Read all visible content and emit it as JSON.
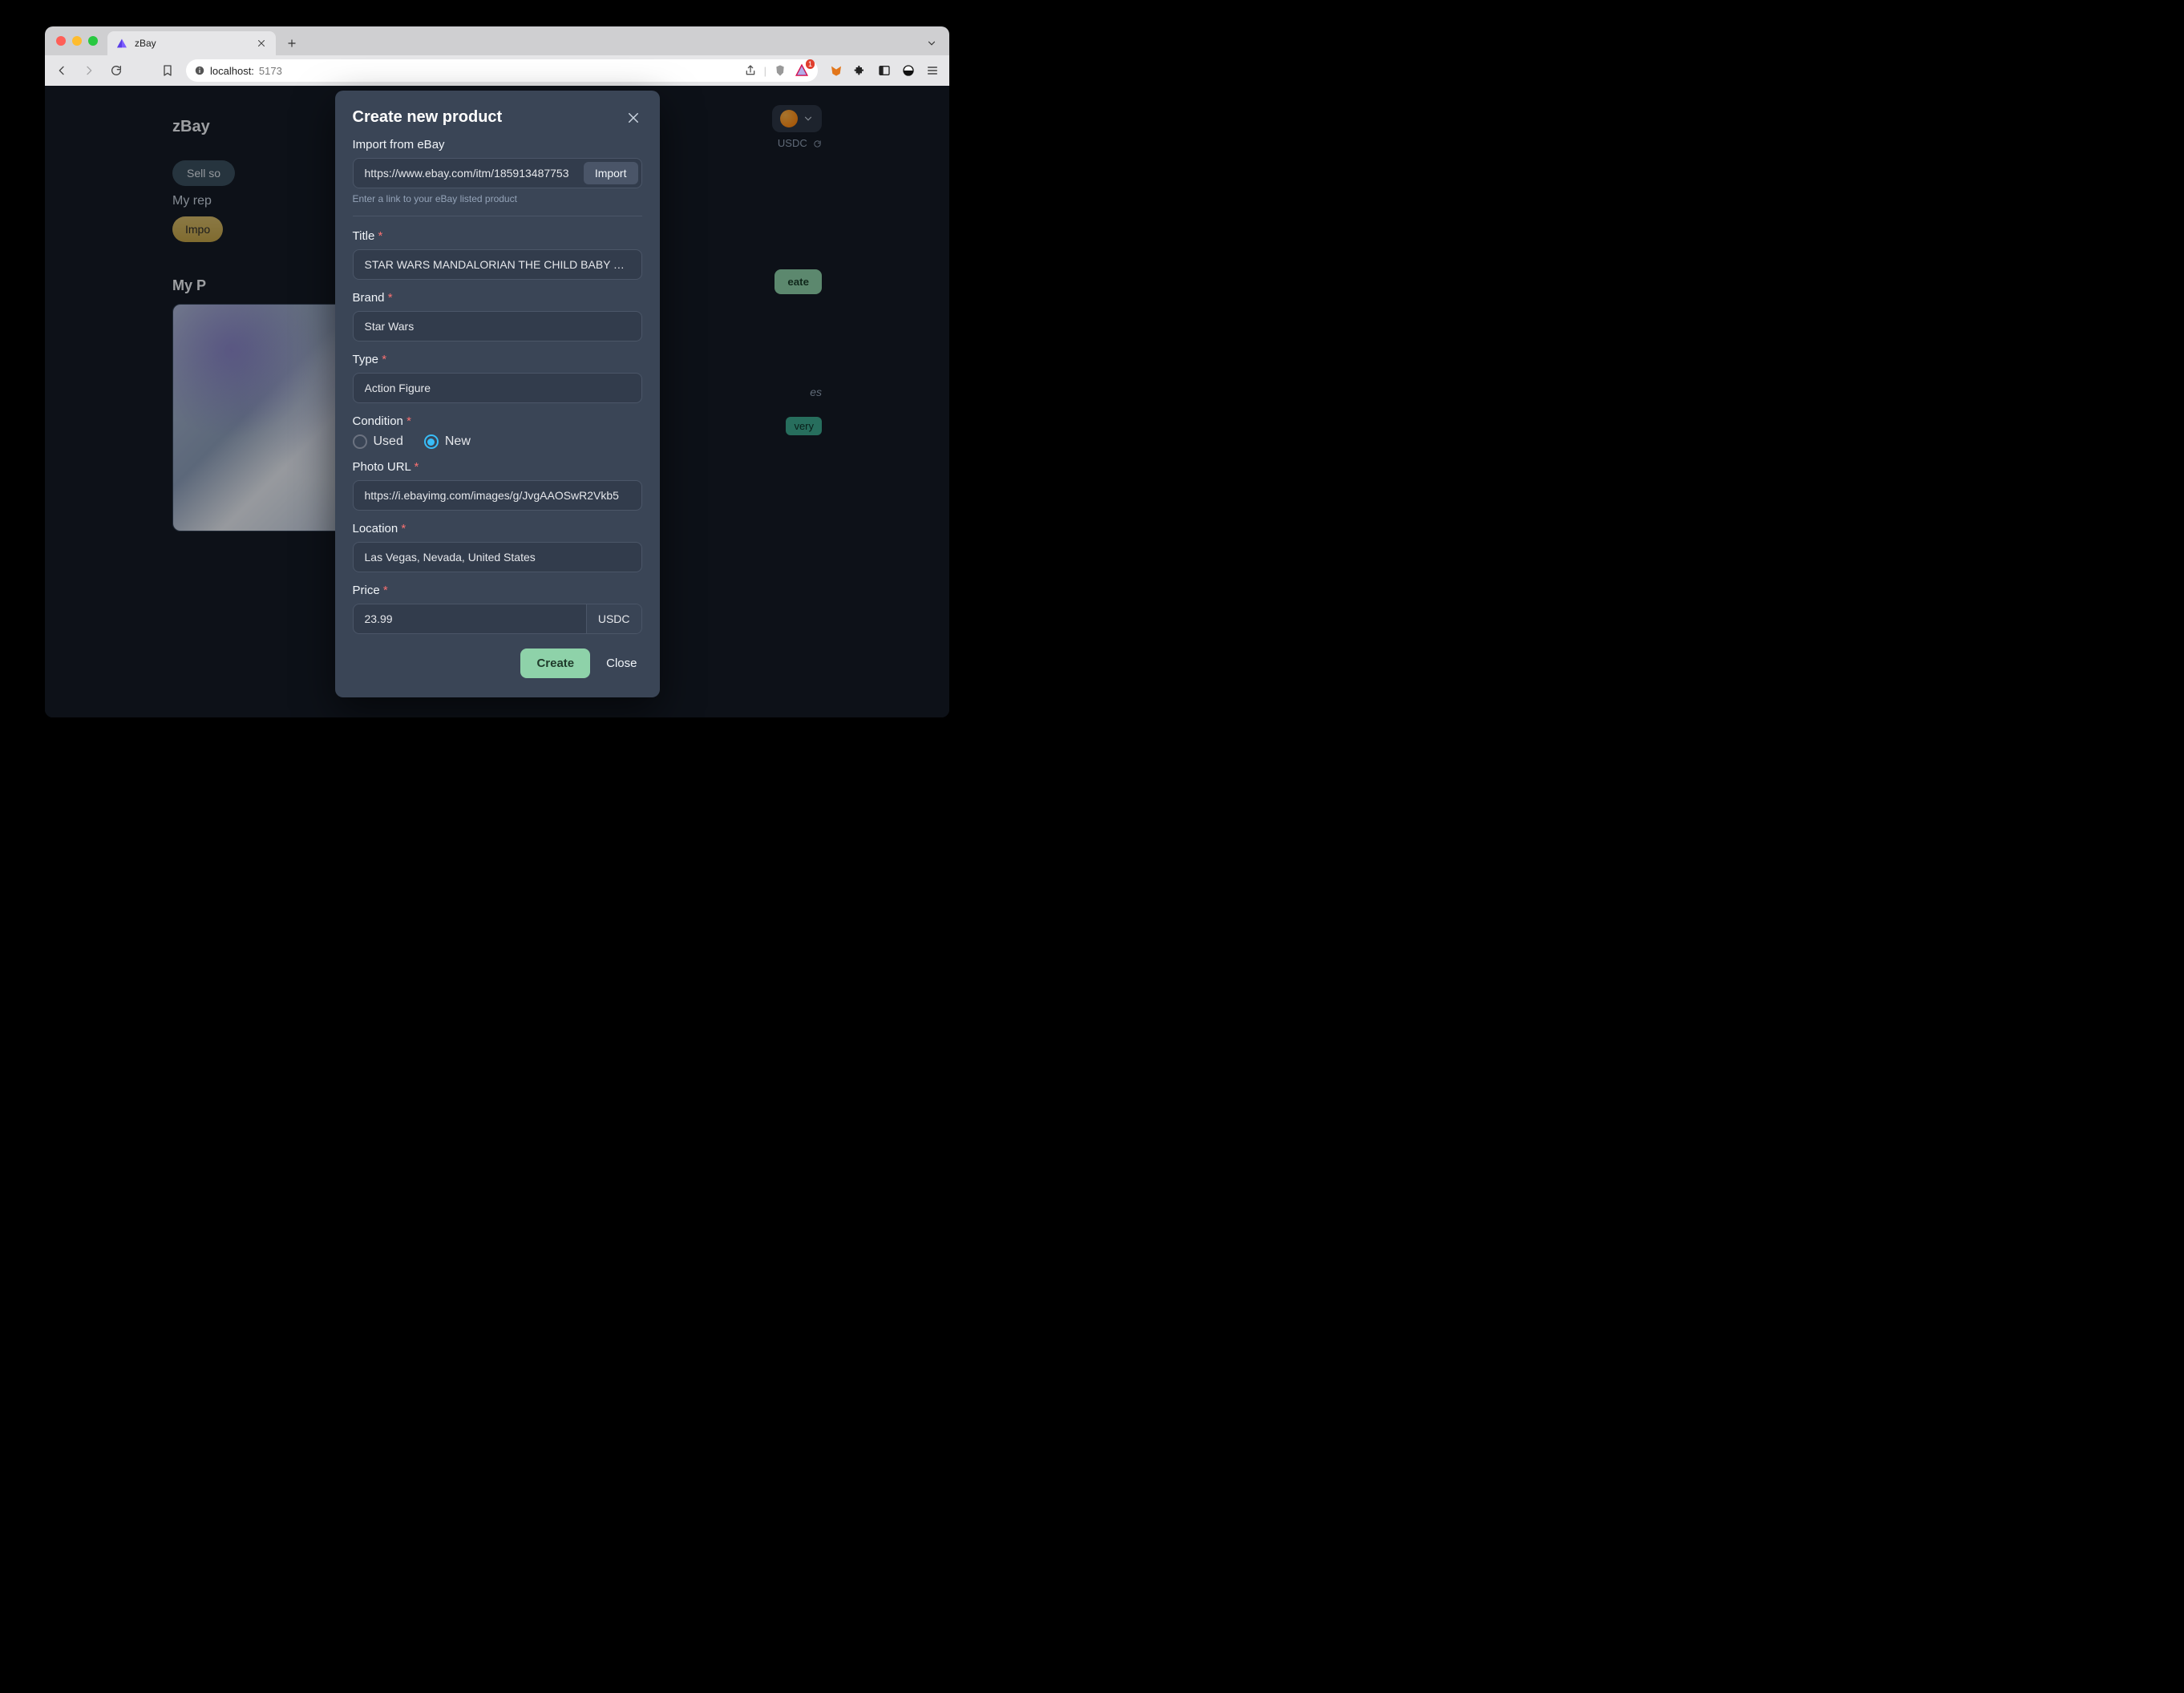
{
  "browser": {
    "tab_title": "zBay",
    "url_host": "localhost:",
    "url_port_path": "5173"
  },
  "page": {
    "logo": "zBay",
    "sell_button": "Sell so",
    "balance_suffix": "USDC",
    "reputation_label": "My rep",
    "import_button": "Impo",
    "products_heading": "My P",
    "create_button_bg": "eate",
    "card_right_text": "es",
    "delivery_badge": "very"
  },
  "modal": {
    "title": "Create new product",
    "import_section_label": "Import from eBay",
    "import_url_value": "https://www.ebay.com/itm/185913487753",
    "import_button": "Import",
    "import_helper": "Enter a link to your eBay listed product",
    "title_label": "Title",
    "title_value": "STAR WARS MANDALORIAN THE CHILD BABY YODA",
    "brand_label": "Brand",
    "brand_value": "Star Wars",
    "type_label": "Type",
    "type_value": "Action Figure",
    "condition_label": "Condition",
    "condition_used": "Used",
    "condition_new": "New",
    "condition_selected": "new",
    "photo_label": "Photo URL",
    "photo_value": "https://i.ebayimg.com/images/g/JvgAAOSwR2Vkb5",
    "location_label": "Location",
    "location_value": "Las Vegas, Nevada, United States",
    "price_label": "Price",
    "price_value": "23.99",
    "price_currency": "USDC",
    "create_button": "Create",
    "close_button": "Close",
    "required_mark": "*"
  }
}
